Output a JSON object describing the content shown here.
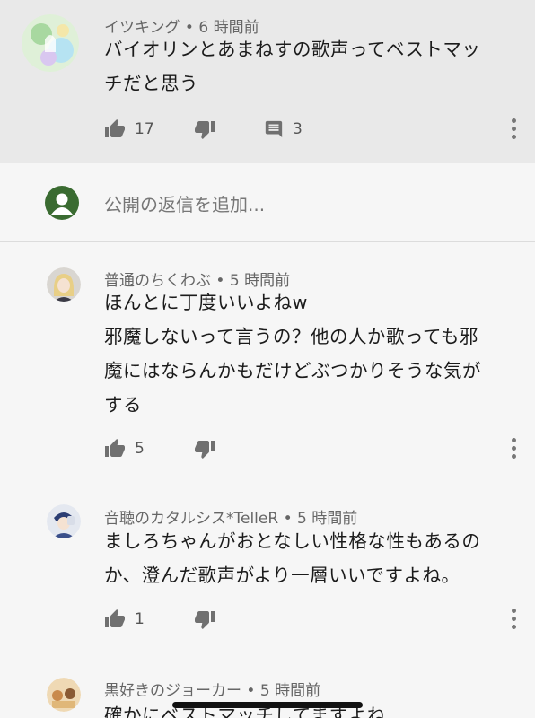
{
  "comments": [
    {
      "author": "イツキング",
      "time": "6 時間前",
      "lines": [
        "バイオリンとあまねすの歌声ってベストマッ",
        "チだと思う"
      ],
      "likes": "17",
      "replies": "3"
    },
    {
      "author": "普通のちくわぶ",
      "time": "5 時間前",
      "lines": [
        "ほんとに丁度いいよねw",
        "邪魔しないって言うの？他の人か歌っても邪",
        "魔にはならんかもだけどぶつかりそうな気が",
        "する"
      ],
      "likes": "5"
    },
    {
      "author": "音聴のカタルシス*TelleR",
      "time": "5 時間前",
      "lines": [
        "ましろちゃんがおとなしい性格な性もあるの",
        "か、澄んだ歌声がより一層いいですよね。"
      ],
      "likes": "1"
    },
    {
      "author": "黒好きのジョーカー",
      "time": "5 時間前",
      "lines": [
        "確かにベストマッチしてますよね"
      ]
    }
  ],
  "reply_box": {
    "placeholder": "公開の返信を追加..."
  },
  "separator": "•",
  "icons": {
    "like": "thumb-up-icon",
    "dislike": "thumb-down-icon",
    "reply": "comment-icon",
    "more": "more-vert-icon"
  },
  "colors": {
    "highlight_bg": "#e9e9e9",
    "page_bg": "#f6f6f6",
    "text": "#1b1b1b",
    "meta": "#666666",
    "icon": "#707070",
    "reply_avatar": "#3a6b31"
  }
}
